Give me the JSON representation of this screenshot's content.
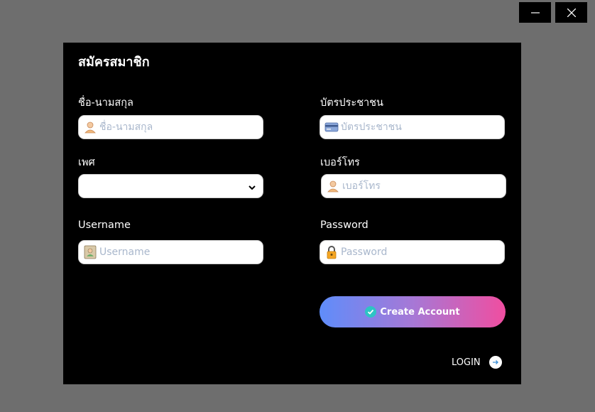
{
  "window": {
    "minimize_icon": "minimize-icon",
    "close_icon": "close-icon"
  },
  "form": {
    "title": "สมัครสมาชิก",
    "fullname": {
      "label": "ชื่อ-นามสกุล",
      "placeholder": "ชื่อ-นามสกุล",
      "icon": "user-icon"
    },
    "id_card": {
      "label": "บัตรประชาชน",
      "placeholder": "บัตรประชาชน",
      "icon": "credit-card-icon"
    },
    "gender": {
      "label": "เพศ",
      "value": "",
      "icon": "chevron-down-icon"
    },
    "phone": {
      "label": "เบอร์โทร",
      "placeholder": "เบอร์โทร",
      "icon": "user-icon"
    },
    "username": {
      "label": "Username",
      "placeholder": "Username",
      "icon": "contact-card-icon"
    },
    "password": {
      "label": "Password",
      "placeholder": "Password",
      "icon": "lock-icon"
    },
    "create_button": {
      "label": "Create Account",
      "icon": "check-circle-icon"
    },
    "login_link": {
      "label": "LOGIN",
      "icon": "arrow-right-circle-icon"
    }
  },
  "colors": {
    "panel": "#000000",
    "backdrop": "#6e6e6e",
    "gradient_start": "#5f8dfa",
    "gradient_end": "#f04ea0",
    "check_accent": "#2ec4c4"
  }
}
